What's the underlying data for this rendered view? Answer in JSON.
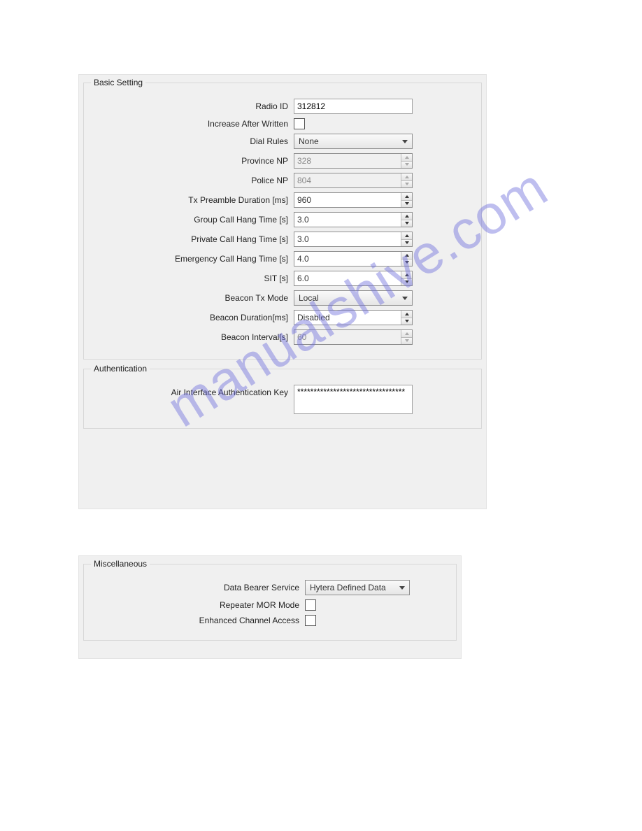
{
  "watermark": "manualshive.com",
  "basic": {
    "legend": "Basic Setting",
    "radio_id": {
      "label": "Radio ID",
      "value": "312812"
    },
    "increase_after_written": {
      "label": "Increase After Written",
      "checked": false
    },
    "dial_rules": {
      "label": "Dial Rules",
      "value": "None"
    },
    "province_np": {
      "label": "Province NP",
      "value": "328"
    },
    "police_np": {
      "label": "Police NP",
      "value": "804"
    },
    "tx_preamble": {
      "label": "Tx Preamble Duration [ms]",
      "value": "960"
    },
    "group_hang": {
      "label": "Group Call Hang Time [s]",
      "value": "3.0"
    },
    "private_hang": {
      "label": "Private Call Hang Time [s]",
      "value": "3.0"
    },
    "emergency_hang": {
      "label": "Emergency Call Hang Time [s]",
      "value": "4.0"
    },
    "sit": {
      "label": "SIT [s]",
      "value": "6.0"
    },
    "beacon_tx_mode": {
      "label": "Beacon Tx Mode",
      "value": "Local"
    },
    "beacon_duration": {
      "label": "Beacon Duration[ms]",
      "value": "Disabled"
    },
    "beacon_interval": {
      "label": "Beacon Interval[s]",
      "value": "60"
    }
  },
  "auth": {
    "legend": "Authentication",
    "air_key": {
      "label": "Air Interface Authentication Key",
      "value": "*********************************"
    }
  },
  "misc": {
    "legend": "Miscellaneous",
    "data_bearer": {
      "label": "Data Bearer Service",
      "value": "Hytera Defined Data"
    },
    "repeater_mor": {
      "label": "Repeater MOR Mode",
      "checked": false
    },
    "enhanced_channel": {
      "label": "Enhanced Channel Access",
      "checked": false
    }
  }
}
